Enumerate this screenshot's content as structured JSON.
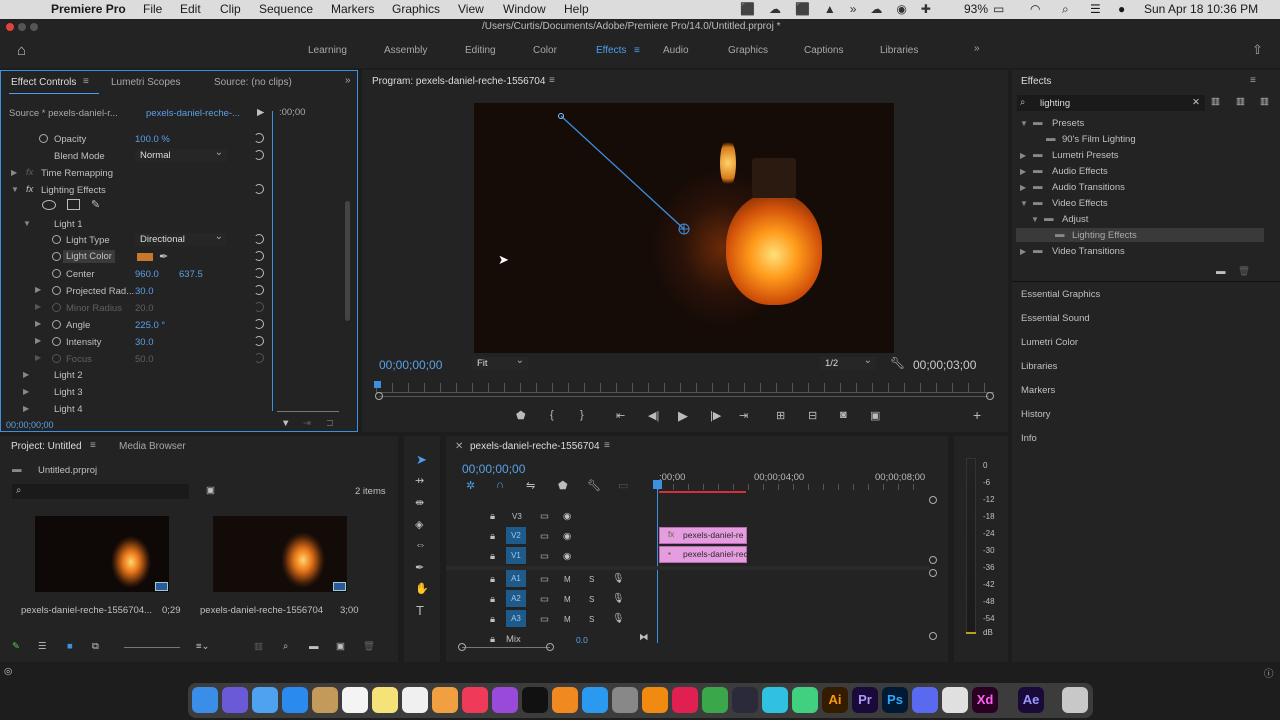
{
  "menubar": {
    "app": "Premiere Pro",
    "items": [
      "File",
      "Edit",
      "Clip",
      "Sequence",
      "Markers",
      "Graphics",
      "View",
      "Window",
      "Help"
    ],
    "battery": "93%",
    "datetime": "Sun Apr 18  10:36 PM"
  },
  "titlebar": {
    "path": "/Users/Curtis/Documents/Adobe/Premiere Pro/14.0/Untitled.prproj *"
  },
  "workspaces": [
    "Learning",
    "Assembly",
    "Editing",
    "Color",
    "Effects",
    "Audio",
    "Graphics",
    "Captions",
    "Libraries"
  ],
  "effect_controls": {
    "tabs": [
      "Effect Controls",
      "Lumetri Scopes",
      "Source: (no clips)"
    ],
    "source": "Source * pexels-daniel-r...",
    "clip": "pexels-daniel-reche-...",
    "ruler_time": ":00;00",
    "rows": [
      {
        "label": "Opacity",
        "value": "100.0 %"
      },
      {
        "label": "Blend Mode",
        "value": "Normal"
      },
      {
        "label": "Time Remapping"
      },
      {
        "label": "Lighting Effects"
      },
      {
        "label": "Light 1"
      },
      {
        "label": "Light Type",
        "value": "Directional"
      },
      {
        "label": "Light Color"
      },
      {
        "label": "Center",
        "value": "960.0",
        "value2": "637.5"
      },
      {
        "label": "Projected Rad...",
        "value": "30.0"
      },
      {
        "label": "Minor Radius",
        "value": "20.0"
      },
      {
        "label": "Angle",
        "value": "225.0 °"
      },
      {
        "label": "Intensity",
        "value": "30.0"
      },
      {
        "label": "Focus",
        "value": "50.0"
      },
      {
        "label": "Light 2"
      },
      {
        "label": "Light 3"
      },
      {
        "label": "Light 4"
      }
    ],
    "timecode": "00;00;00;00",
    "light_color": "#c8782c"
  },
  "program": {
    "title": "Program: pexels-daniel-reche-1556704",
    "timecode_left": "00;00;00;00",
    "fit": "Fit",
    "resolution": "1/2",
    "timecode_right": "00;00;03;00"
  },
  "effects_panel": {
    "title": "Effects",
    "search": "lighting",
    "tree": [
      {
        "label": "Presets"
      },
      {
        "label": "90's Film Lighting"
      },
      {
        "label": "Lumetri Presets"
      },
      {
        "label": "Audio Effects"
      },
      {
        "label": "Audio Transitions"
      },
      {
        "label": "Video Effects"
      },
      {
        "label": "Adjust"
      },
      {
        "label": "Lighting Effects"
      },
      {
        "label": "Video Transitions"
      }
    ],
    "panels": [
      "Essential Graphics",
      "Essential Sound",
      "Lumetri Color",
      "Libraries",
      "Markers",
      "History",
      "Info"
    ]
  },
  "project": {
    "tabs": [
      "Project: Untitled",
      "Media Browser"
    ],
    "file": "Untitled.prproj",
    "count": "2 items",
    "items": [
      {
        "name": "pexels-daniel-reche-1556704...",
        "dur": "0;29"
      },
      {
        "name": "pexels-daniel-reche-1556704",
        "dur": "3;00"
      }
    ]
  },
  "timeline": {
    "title": "pexels-daniel-reche-1556704",
    "timecode": "00;00;00;00",
    "ruler": [
      ":00;00",
      "00;00;04;00",
      "00;00;08;00"
    ],
    "tracks": [
      "V3",
      "V2",
      "V1",
      "A1",
      "A2",
      "A3"
    ],
    "mix": "Mix",
    "mix_val": "0.0",
    "clip_v2": "pexels-daniel-re",
    "clip_v1": "pexels-daniel-rec",
    "m": "M",
    "s": "S"
  },
  "meter": {
    "scale": [
      "0",
      "-6",
      "-12",
      "-18",
      "-24",
      "-30",
      "-36",
      "-42",
      "-48",
      "-54",
      "dB"
    ]
  }
}
